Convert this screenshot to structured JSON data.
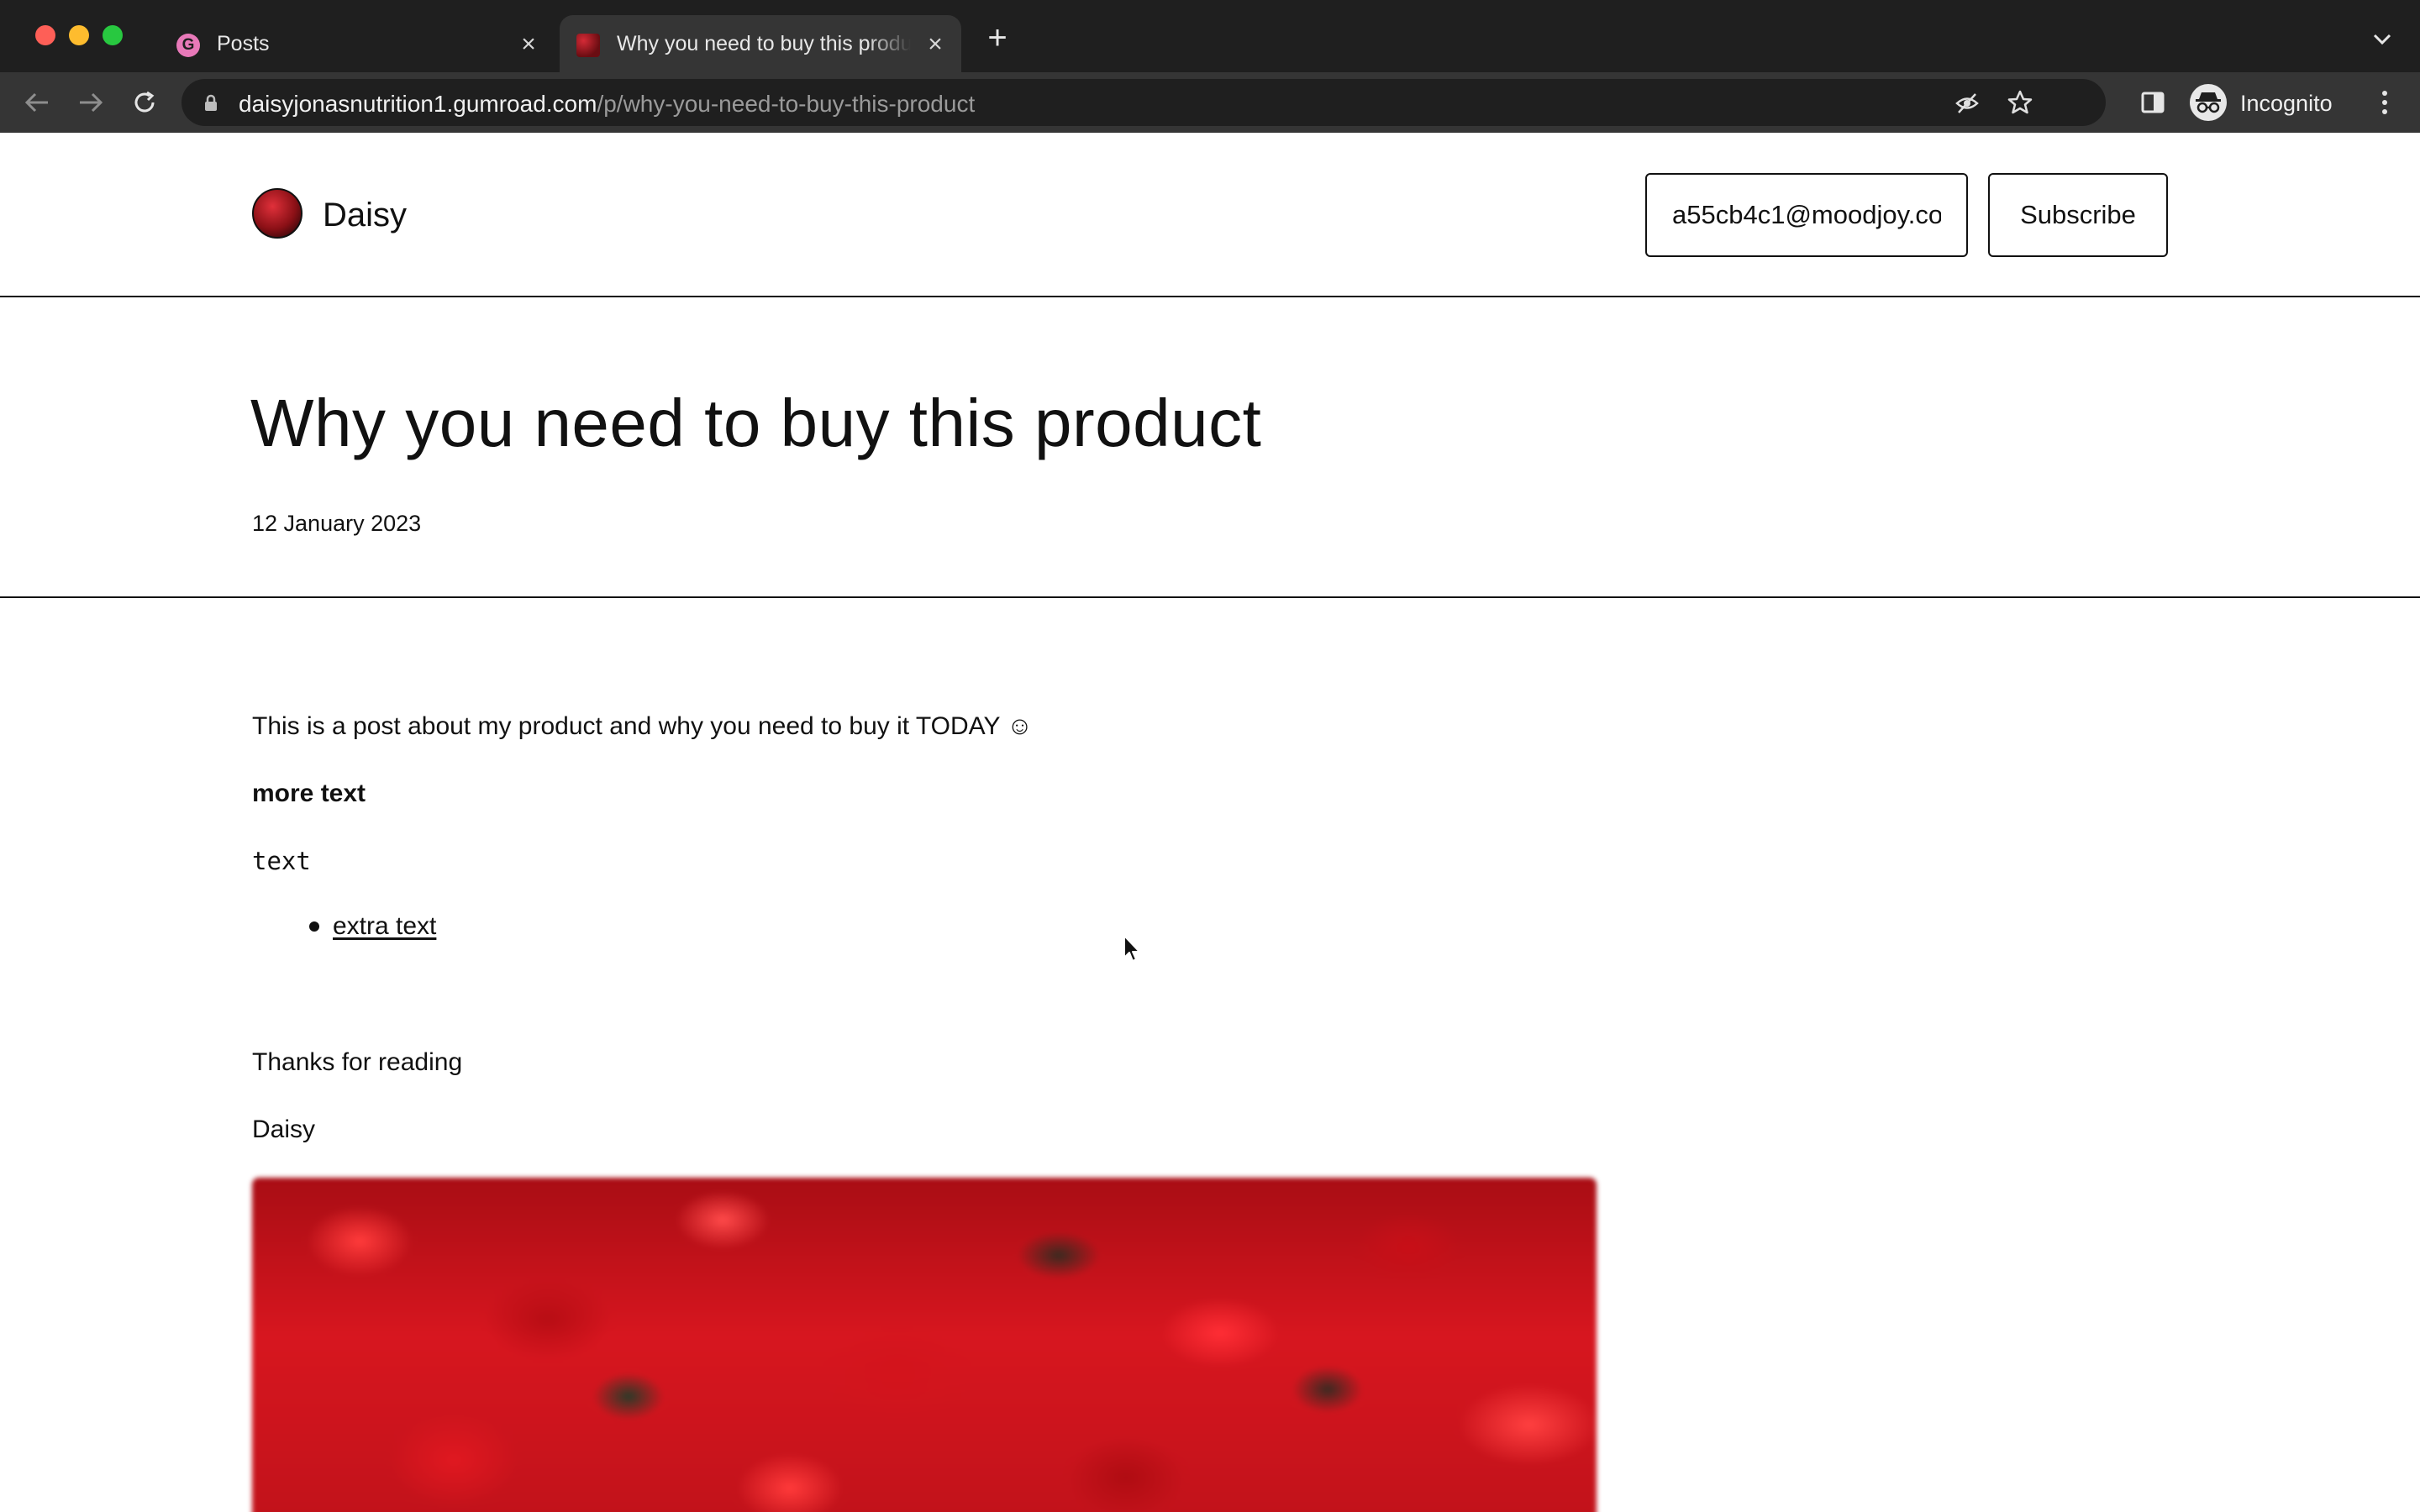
{
  "browser": {
    "tabs": [
      {
        "title": "Posts",
        "favicon": "G",
        "active": false
      },
      {
        "title": "Why you need to buy this product",
        "active": true
      }
    ],
    "url": {
      "host": "daisyjonasnutrition1.gumroad.com",
      "path": "/p/why-you-need-to-buy-this-product"
    },
    "profile_label": "Incognito"
  },
  "site": {
    "brand_name": "Daisy",
    "email_value": "a55cb4c1@moodjoy.co",
    "subscribe_label": "Subscribe"
  },
  "post": {
    "title": "Why you need to buy this product",
    "date": "12 January 2023",
    "paragraphs": {
      "intro": "This is a post about my product and why you need to buy it TODAY ☺",
      "bold": "more text",
      "text": "text",
      "bullet_link": "extra text",
      "thanks": "Thanks for reading",
      "signoff": "Daisy"
    }
  },
  "colors": {
    "tab_bar": "#1f1f1f",
    "toolbar": "#353535",
    "text": "#111111",
    "gumroad_pink": "#e879b9"
  }
}
